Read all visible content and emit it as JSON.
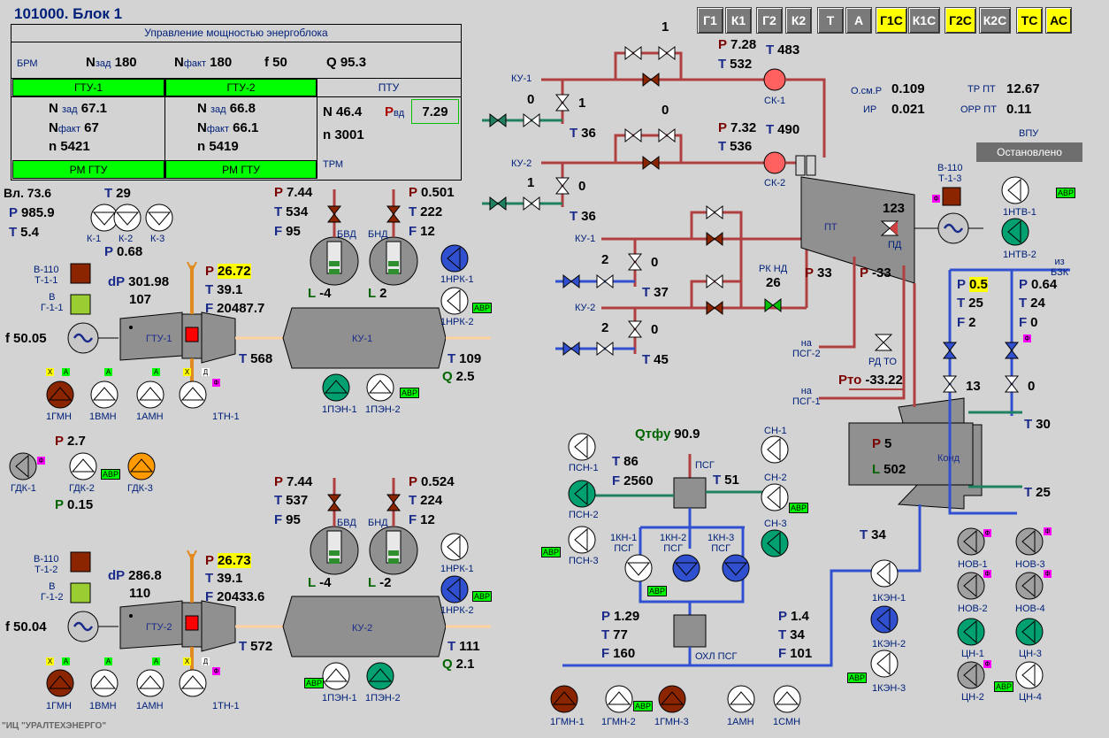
{
  "title": "101000. Блок 1",
  "modes": [
    {
      "label": "Г1",
      "active": false
    },
    {
      "label": "К1",
      "active": false
    },
    {
      "label": "Г2",
      "active": false
    },
    {
      "label": "К2",
      "active": false
    },
    {
      "label": "Т",
      "active": false
    },
    {
      "label": "А",
      "active": false
    },
    {
      "label": "Г1С",
      "active": true
    },
    {
      "label": "К1С",
      "active": false
    },
    {
      "label": "Г2С",
      "active": true
    },
    {
      "label": "К2С",
      "active": false
    },
    {
      "label": "ТС",
      "active": true
    },
    {
      "label": "АС",
      "active": true
    }
  ],
  "power": {
    "header": "Управление мощностью энергоблока",
    "brm": "БРМ",
    "n_zad_l": "N зад",
    "n_zad": "180",
    "n_fact_l": "N факт",
    "n_fact": "180",
    "f_l": "f",
    "f": "50",
    "q_l": "Q",
    "q": "95.3",
    "gtu1": {
      "title": "ГТУ-1",
      "n_zad": "67.1",
      "n_fact": "67",
      "n": "5421",
      "rm": "РМ ГТУ"
    },
    "gtu2": {
      "title": "ГТУ-2",
      "n_zad": "66.8",
      "n_fact": "66.1",
      "n": "5419",
      "rm": "РМ ГТУ"
    },
    "ptu": {
      "title": "ПТУ",
      "n": "46.4",
      "p_vd_l": "Р вд",
      "p_vd": "7.29",
      "n2": "3001",
      "trm": "ТРМ"
    },
    "lbl_nzad": "зад",
    "lbl_nfact": "факт"
  },
  "ambient": {
    "vl": "Вл. 73.6",
    "p": "985.9",
    "t": "5.4",
    "t_k": "29",
    "p_k": "0.68",
    "k1": "К-1",
    "k2": "К-2",
    "k3": "К-3"
  },
  "gtu1": {
    "v110": "В-110\nТ-1-1",
    "vg": "В\nГ-1-1",
    "dp": "301.98",
    "t_in": "107",
    "p": "26.72",
    "t": "39.1",
    "f": "20487.7",
    "freq": "50.05",
    "name": "ГТУ-1",
    "t_out": "568",
    "pumps": [
      "1ГМН",
      "1ВМН",
      "1АМН",
      "1ТН-1"
    ]
  },
  "ku1": {
    "name": "КУ-1",
    "p_bvd": "7.44",
    "t_bvd": "534",
    "f_bvd": "95",
    "p_bnd": "0.501",
    "t_bnd": "222",
    "f_bnd": "12",
    "l_bvd": "-4",
    "l_bnd": "2",
    "t_out": "109",
    "q_out": "2.5",
    "bvd": "БВД",
    "bnd": "БНД",
    "nrk1": "1НРК-1",
    "nrk2": "1НРК-2",
    "pen1": "1ПЭН-1",
    "pen2": "1ПЭН-2"
  },
  "gdk": {
    "p": "2.7",
    "p2": "0.15",
    "gdk1": "ГДК-1",
    "gdk2": "ГДК-2",
    "gdk3": "ГДК-3"
  },
  "gtu2": {
    "v110": "В-110\nТ-1-2",
    "vg": "В\nГ-1-2",
    "dp": "286.8",
    "t_in": "110",
    "p": "26.73",
    "t": "39.1",
    "f": "20433.6",
    "freq": "50.04",
    "name": "ГТУ-2",
    "t_out": "572",
    "pumps": [
      "1ГМН",
      "1ВМН",
      "1АМН",
      "1ТН-1"
    ]
  },
  "ku2": {
    "name": "КУ-2",
    "p_bvd": "7.44",
    "t_bvd": "537",
    "f_bvd": "95",
    "p_bnd": "0.524",
    "t_bnd": "224",
    "f_bnd": "12",
    "l_bvd": "-4",
    "l_bnd": "-2",
    "t_out": "111",
    "q_out": "2.1",
    "bvd": "БВД",
    "bnd": "БНД",
    "nrk1": "1НРК-1",
    "nrk2": "1НРК-2",
    "pen1": "1ПЭН-1",
    "pen2": "1ПЭН-2"
  },
  "steam": {
    "ku1_top": "КУ-1",
    "ku2_top": "КУ-2",
    "ku1_low": "КУ-1",
    "ku2_low": "КУ-2",
    "v_top": "1",
    "p_sk1": "7.28",
    "t_sk1": "532",
    "t_sk1b": "483",
    "sk1": "СК-1",
    "v1": "0",
    "v1b": "1",
    "t36a": "36",
    "v2": "0",
    "p_sk2": "7.32",
    "t_sk2": "536",
    "t_sk2b": "490",
    "sk2": "СК-2",
    "v3": "1",
    "v3b": "0",
    "t36b": "36",
    "v4": "2",
    "v4b": "0",
    "t37": "37",
    "v5": "2",
    "v5b": "0",
    "t45": "45",
    "rknd": "РК НД",
    "rknd_v": "26",
    "p33": "33",
    "p_m33": "-33",
    "psg2": "на\nПСГ-2",
    "psg1": "на\nПСГ-1",
    "rdto": "РД ТО",
    "pto": "-33.22"
  },
  "turbine": {
    "pt": "ПТ",
    "pd_v": "123",
    "pd": "ПД",
    "osm": "О.см.Р",
    "osm_v": "0.109",
    "ir": "ИР",
    "ir_v": "0.021",
    "trpt": "ТР ПТ",
    "trpt_v": "12.67",
    "orrpt": "ОРР ПТ",
    "orrpt_v": "0.11",
    "vpu": "ВПУ",
    "status": "Остановлено",
    "v110": "В-110\nТ-1-3",
    "ntv1": "1НТВ-1",
    "ntv2": "1НТВ-2"
  },
  "cond": {
    "bzk": "из\nБЗК",
    "p1": "0.5",
    "t1": "25",
    "f1": "2",
    "p2": "0.64",
    "t2": "24",
    "f2": "0",
    "v13": "13",
    "v0": "0",
    "t30": "30",
    "t25": "25",
    "name": "Конд",
    "p": "5",
    "l": "502",
    "t34": "34",
    "ken1": "1КЭН-1",
    "ken2": "1КЭН-2",
    "ken3": "1КЭН-3"
  },
  "psg": {
    "q": "90.9",
    "t": "86",
    "f": "2560",
    "t51": "51",
    "psg": "ПСГ",
    "psn1": "ПСН-1",
    "psn2": "ПСН-2",
    "psn3": "ПСН-3",
    "kn1": "1КН-1\nПСГ",
    "kn2": "1КН-2\nПСГ",
    "kn3": "1КН-3\nПСГ",
    "p_b": "1.29",
    "t_b": "77",
    "f_b": "160",
    "p_c": "1.4",
    "t_c": "34",
    "f_c": "101",
    "ohl": "ОХЛ ПСГ",
    "sn1": "СН-1",
    "sn2": "СН-2",
    "sn3": "СН-3"
  },
  "right_pumps": {
    "nov1": "НОВ-1",
    "nov2": "НОВ-2",
    "nov3": "НОВ-3",
    "nov4": "НОВ-4",
    "cn1": "ЦН-1",
    "cn2": "ЦН-2",
    "cn3": "ЦН-3",
    "cn4": "ЦН-4"
  },
  "bottom_pumps": [
    "1ГМН-1",
    "1ГМН-2",
    "1ГМН-3",
    "1АМН",
    "1СМН"
  ],
  "footer": "\"ИЦ \"УРАЛТЕХЭНЕРГО\"",
  "avr": "АВР",
  "fm": "Ф",
  "x": "Х",
  "a": "А",
  "d": "Д"
}
